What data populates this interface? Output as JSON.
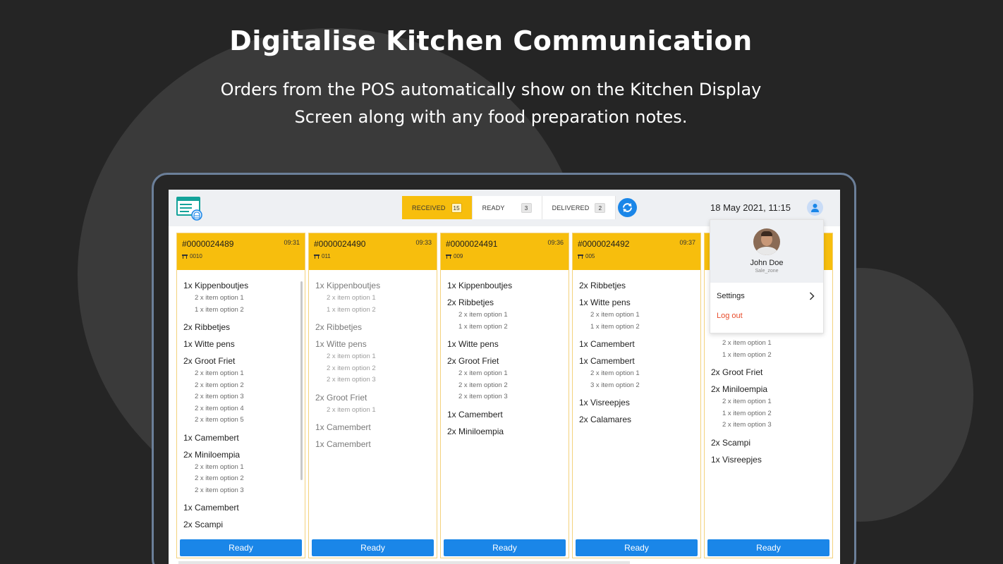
{
  "headline": "Digitalise Kitchen Communication",
  "subline_1": "Orders from the POS automatically show on the Kitchen Display",
  "subline_2": "Screen along with any food preparation notes.",
  "colors": {
    "accent": "#f7be0d",
    "primary": "#1a86e8",
    "danger": "#e84b2a"
  },
  "tabs": [
    {
      "label": "RECEIVED",
      "count": "15"
    },
    {
      "label": "READY",
      "count": "3"
    },
    {
      "label": "DELIVERED",
      "count": "2"
    }
  ],
  "datetime": "18 May 2021, 11:15",
  "ready_label": "Ready",
  "orders": [
    {
      "id": "#0000024489",
      "time": "09:31",
      "table": "0010",
      "items": [
        {
          "name": "1x Kippenboutjes",
          "options": [
            "2 x item option 1",
            "1 x item option 2"
          ]
        },
        {
          "name": "2x Ribbetjes",
          "options": []
        },
        {
          "name": "1x Witte pens",
          "options": []
        },
        {
          "name": "2x Groot Friet",
          "options": [
            "2 x item option 1",
            "2 x item option 2",
            "2 x item option 3",
            "2 x item option 4",
            "2 x item option 5"
          ]
        },
        {
          "name": "1x Camembert",
          "options": []
        },
        {
          "name": "2x Miniloempia",
          "options": [
            "2 x item option 1",
            "2 x item option 2",
            "2 x item option 3"
          ]
        },
        {
          "name": "1x Camembert",
          "options": []
        },
        {
          "name": "2x Scampi",
          "options": []
        }
      ]
    },
    {
      "id": "#0000024490",
      "time": "09:33",
      "table": "011",
      "items": [
        {
          "name": "1x Kippenboutjes",
          "options": [
            "2 x item option 1",
            "1 x item option 2"
          ]
        },
        {
          "name": "2x Ribbetjes",
          "options": []
        },
        {
          "name": "1x Witte pens",
          "options": [
            "2 x item option 1",
            "2 x item option 2",
            "2 x item option 3"
          ]
        },
        {
          "name": "2x Groot Friet",
          "options": [
            "2 x item option 1"
          ]
        },
        {
          "name": "1x Camembert",
          "options": []
        },
        {
          "name": "1x Camembert",
          "options": []
        }
      ]
    },
    {
      "id": "#0000024491",
      "time": "09:36",
      "table": "009",
      "items": [
        {
          "name": "1x Kippenboutjes",
          "options": []
        },
        {
          "name": "2x Ribbetjes",
          "options": [
            "2 x item option 1",
            "1 x item option 2"
          ]
        },
        {
          "name": "1x Witte pens",
          "options": []
        },
        {
          "name": "2x Groot Friet",
          "options": [
            "2 x item option 1",
            "2 x item option 2",
            "2 x item option 3"
          ]
        },
        {
          "name": "1x Camembert",
          "options": []
        },
        {
          "name": "2x Miniloempia",
          "options": []
        }
      ]
    },
    {
      "id": "#0000024492",
      "time": "09:37",
      "table": "005",
      "items": [
        {
          "name": "2x Ribbetjes",
          "options": []
        },
        {
          "name": "1x Witte pens",
          "options": [
            "2 x item option 1",
            "1 x item option 2"
          ]
        },
        {
          "name": "1x Camembert",
          "options": []
        },
        {
          "name": "1x Camembert",
          "options": [
            "2 x item option 1",
            "3 x item option 2"
          ]
        },
        {
          "name": "1x Visreepjes",
          "options": []
        },
        {
          "name": "2x Calamares",
          "options": []
        }
      ]
    },
    {
      "id": "",
      "time": "",
      "table": "",
      "items_partial": [
        {
          "name": "",
          "options": [
            "2 x item option 1",
            "1 x item option 2"
          ]
        },
        {
          "name": "2x Groot Friet",
          "options": []
        },
        {
          "name": "2x Miniloempia",
          "options": [
            "2 x item option 1",
            "1 x item option 2",
            "2 x item option 3"
          ]
        },
        {
          "name": "2x Scampi",
          "options": []
        },
        {
          "name": "1x Visreepjes",
          "options": []
        }
      ]
    }
  ],
  "menu": {
    "user_name": "John Doe",
    "user_zone": "Sale_zone",
    "settings_label": "Settings",
    "logout_label": "Log out"
  }
}
